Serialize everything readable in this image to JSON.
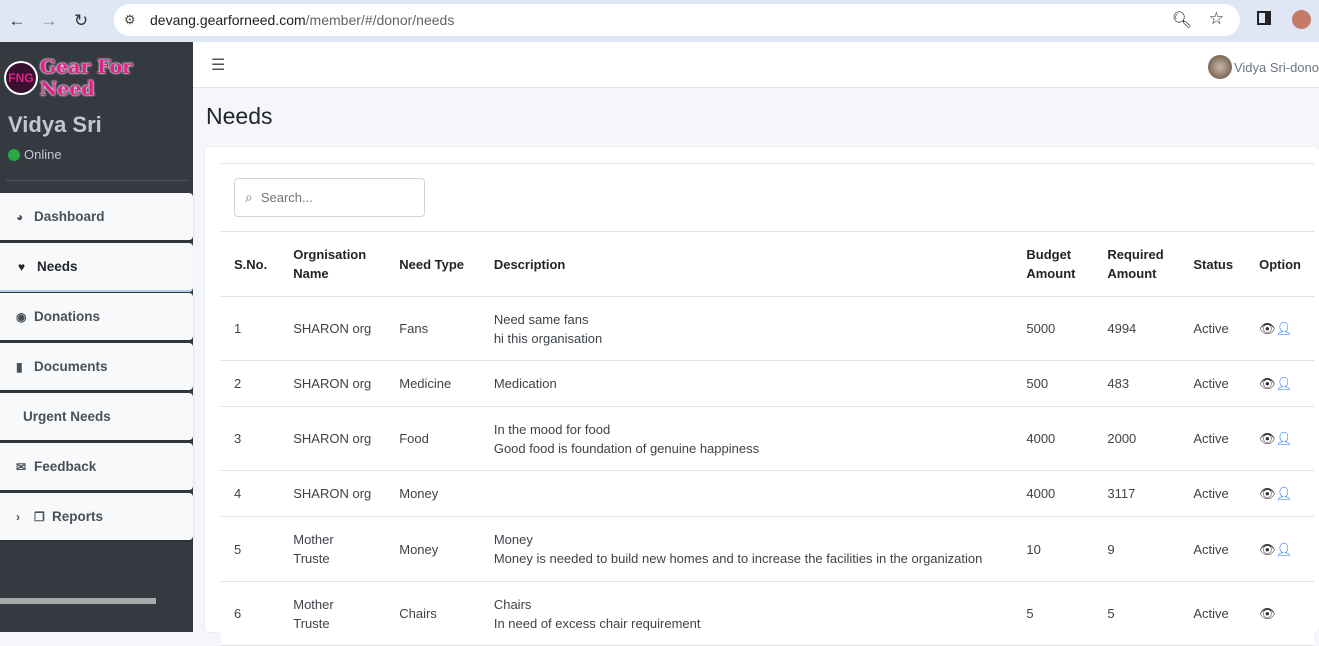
{
  "browser": {
    "url_host": "devang.gearforneed.com",
    "url_path": "/member/#/donor/needs"
  },
  "sidebar": {
    "logo_text": "Gear For Need",
    "logo_mark": "FNG",
    "user_name": "Vidya Sri",
    "status": "Online",
    "items": [
      {
        "label": "Dashboard",
        "icon": "chart-pie-icon"
      },
      {
        "label": "Needs",
        "icon": "hand-holding-heart-icon"
      },
      {
        "label": "Donations",
        "icon": "donate-icon"
      },
      {
        "label": "Documents",
        "icon": "file-icon"
      },
      {
        "label": "Urgent Needs",
        "icon": ""
      },
      {
        "label": "Feedback",
        "icon": "envelope-icon"
      },
      {
        "label": "Reports",
        "icon": "copy-icon"
      }
    ],
    "active": "Needs"
  },
  "topbar": {
    "user_label": "Vidya Sri-dono"
  },
  "page": {
    "title": "Needs",
    "search_placeholder": "Search..."
  },
  "table": {
    "headers": [
      "S.No.",
      "Orgnisation Name",
      "Need Type",
      "Description",
      "Budget Amount",
      "Required Amount",
      "Status",
      "Option"
    ],
    "rows": [
      {
        "sno": "1",
        "org": "SHARON org",
        "type": "Fans",
        "desc1": "Need same fans",
        "desc2": "hi this organisation",
        "budget": "5000",
        "required": "4994",
        "status": "Active",
        "user_icon": true
      },
      {
        "sno": "2",
        "org": "SHARON org",
        "type": "Medicine",
        "desc1": "Medication",
        "desc2": "",
        "budget": "500",
        "required": "483",
        "status": "Active",
        "user_icon": true
      },
      {
        "sno": "3",
        "org": "SHARON org",
        "type": "Food",
        "desc1": "In the mood for food",
        "desc2": "Good food is foundation of genuine happiness",
        "budget": "4000",
        "required": "2000",
        "status": "Active",
        "user_icon": true
      },
      {
        "sno": "4",
        "org": "SHARON org",
        "type": "Money",
        "desc1": "",
        "desc2": "",
        "budget": "4000",
        "required": "3117",
        "status": "Active",
        "user_icon": true
      },
      {
        "sno": "5",
        "org": "Mother Truste",
        "type": "Money",
        "desc1": "Money",
        "desc2": "Money is needed to build new homes and to increase the facilities in the organization",
        "budget": "10",
        "required": "9",
        "status": "Active",
        "user_icon": true
      },
      {
        "sno": "6",
        "org": "Mother Truste",
        "type": "Chairs",
        "desc1": "Chairs",
        "desc2": "In need of excess chair requirement",
        "budget": "5",
        "required": "5",
        "status": "Active",
        "user_icon": false
      }
    ]
  },
  "colors": {
    "sidebar": "#343a40",
    "accent": "#0d6efd",
    "online": "#28a745",
    "logo": "#e0218a"
  }
}
